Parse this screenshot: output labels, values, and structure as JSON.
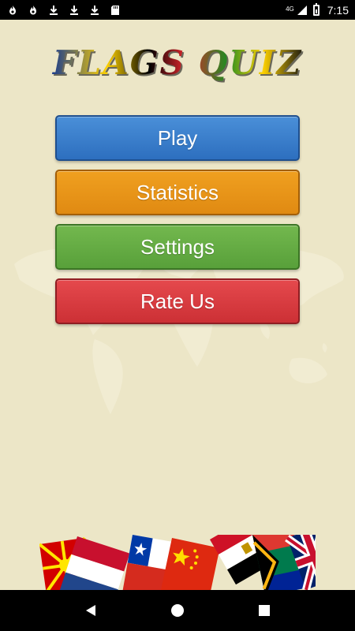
{
  "status_bar": {
    "left_icons": [
      "flame-icon",
      "flame-icon",
      "download-icon",
      "download-icon",
      "download-icon",
      "sd-card-icon"
    ],
    "network_label": "4G",
    "time": "7:15"
  },
  "app": {
    "title": "FLAGS QUIZ",
    "menu": {
      "play_label": "Play",
      "statistics_label": "Statistics",
      "settings_label": "Settings",
      "rate_label": "Rate Us"
    },
    "colors": {
      "background": "#ece6c7",
      "play": "#3a7fcf",
      "statistics": "#e8951a",
      "settings": "#66ac44",
      "rate": "#d93a3e"
    }
  },
  "nav_bar": {
    "icons": [
      "back-icon",
      "home-icon",
      "recents-icon"
    ]
  }
}
